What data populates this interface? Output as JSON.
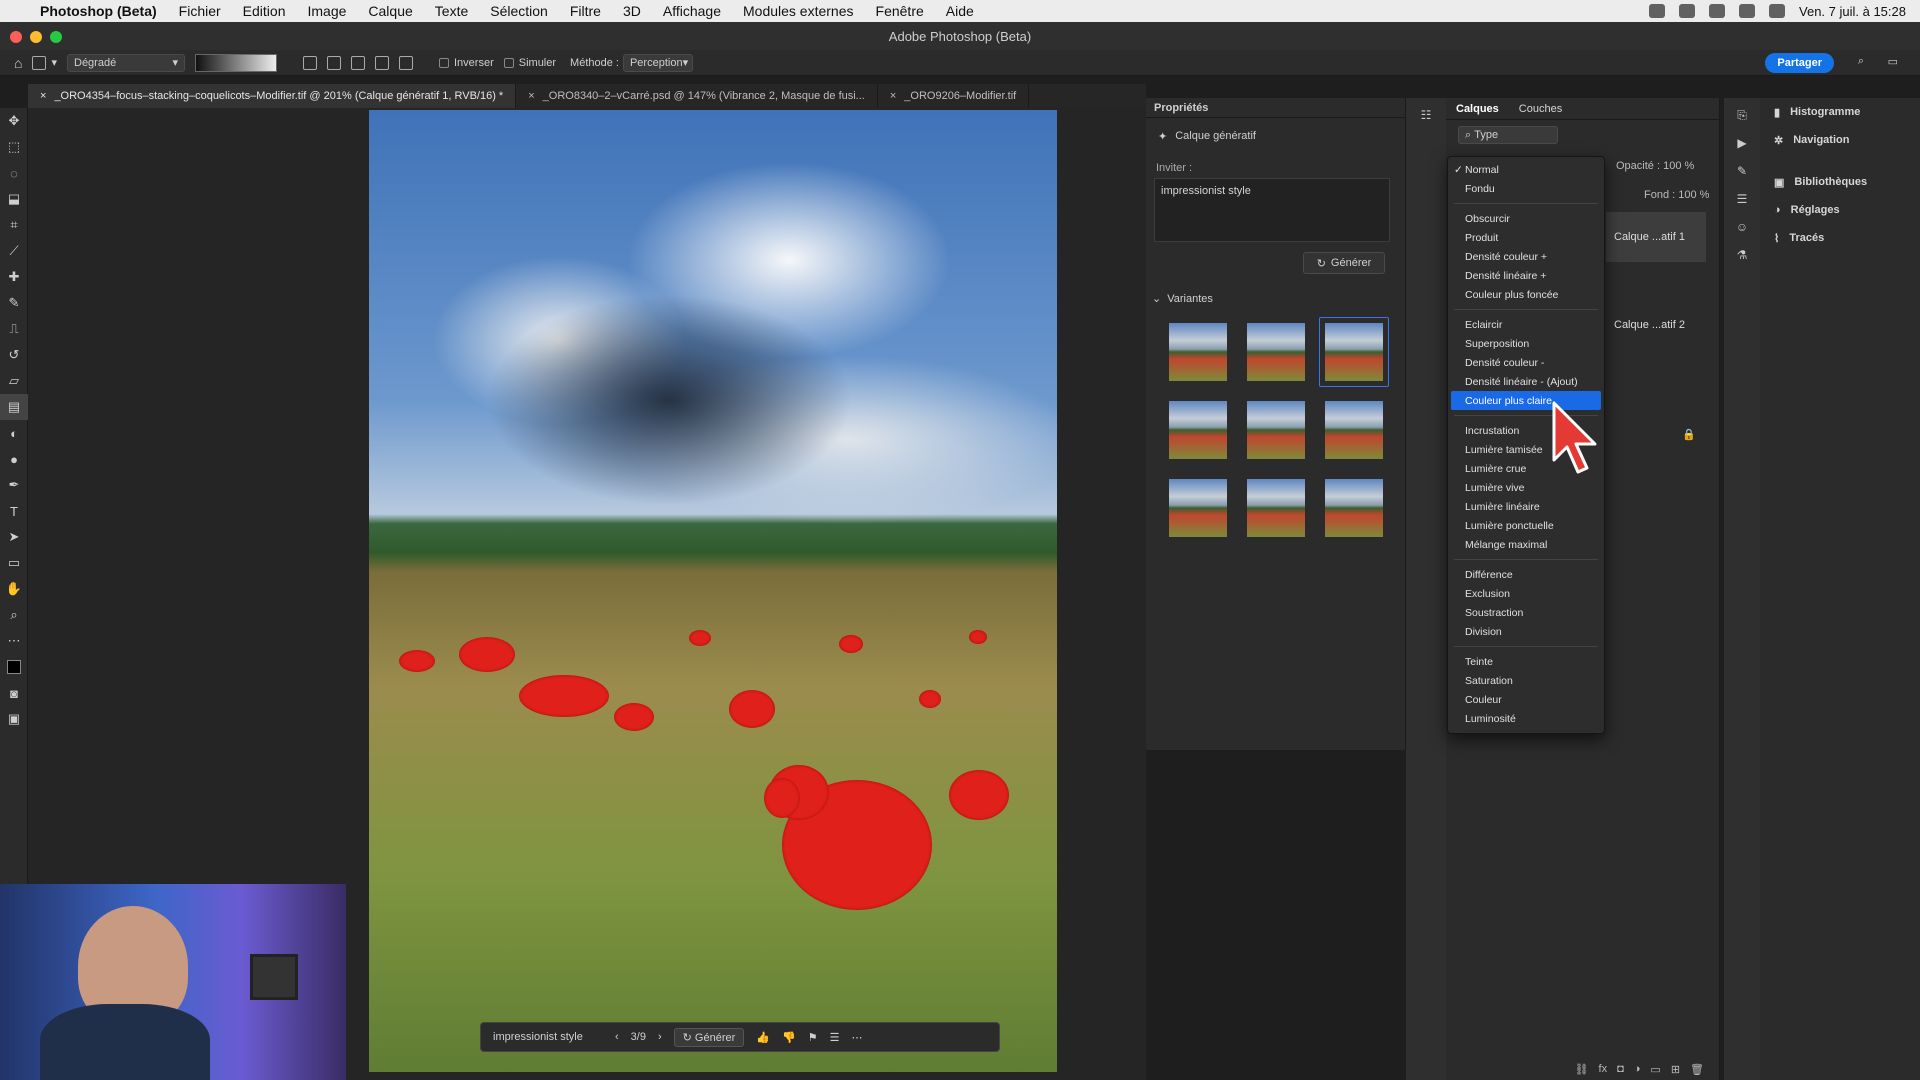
{
  "menubar": {
    "app_name": "Photoshop (Beta)",
    "items": [
      "Fichier",
      "Edition",
      "Image",
      "Calque",
      "Texte",
      "Sélection",
      "Filtre",
      "3D",
      "Affichage",
      "Modules externes",
      "Fenêtre",
      "Aide"
    ],
    "clock": "Ven. 7 juil. à 15:28"
  },
  "window": {
    "title": "Adobe Photoshop (Beta)"
  },
  "options": {
    "tool": "Dégradé",
    "inverser": "Inverser",
    "simuler": "Simuler",
    "methode_label": "Méthode :",
    "methode_value": "Perception",
    "share": "Partager"
  },
  "tabs": [
    "_ORO4354–focus–stacking–coquelicots–Modifier.tif @ 201% (Calque génératif 1, RVB/16) *",
    "_ORO8340–2–vCarré.psd @ 147% (Vibrance 2, Masque de fusi...",
    "_ORO9206–Modifier.tif"
  ],
  "genbar": {
    "prompt": "impressionist style",
    "counter": "3/9",
    "generate": "Générer"
  },
  "properties": {
    "title": "Propriétés",
    "layer_type": "Calque génératif",
    "prompt_label": "Inviter :",
    "prompt_value": "impressionist style",
    "generate": "Générer",
    "variants_label": "Variantes"
  },
  "layers": {
    "tab_layers": "Calques",
    "tab_channels": "Couches",
    "filter": "Type",
    "opacity_label": "Opacité : 100 %",
    "fill_label": "Fond : 100 %",
    "rows": [
      "Calque ...atif 1",
      "Calque ...atif 2"
    ]
  },
  "blend_menu": {
    "groups": [
      [
        "Normal",
        "Fondu"
      ],
      [
        "Obscurcir",
        "Produit",
        "Densité couleur +",
        "Densité linéaire +",
        "Couleur plus foncée"
      ],
      [
        "Eclaircir",
        "Superposition",
        "Densité couleur -",
        "Densité linéaire - (Ajout)",
        "Couleur plus claire"
      ],
      [
        "Incrustation",
        "Lumière tamisée",
        "Lumière crue",
        "Lumière vive",
        "Lumière linéaire",
        "Lumière ponctuelle",
        "Mélange maximal"
      ],
      [
        "Différence",
        "Exclusion",
        "Soustraction",
        "Division"
      ],
      [
        "Teinte",
        "Saturation",
        "Couleur",
        "Luminosité"
      ]
    ],
    "checked": "Normal",
    "highlighted": "Couleur plus claire"
  },
  "right_panel": {
    "items": [
      "Histogramme",
      "Navigation",
      "Bibliothèques",
      "Réglages",
      "Tracés"
    ]
  },
  "colors": {
    "accent": "#1a6ae6",
    "panel": "#2b2b2b",
    "poppy": "#e0201b"
  }
}
